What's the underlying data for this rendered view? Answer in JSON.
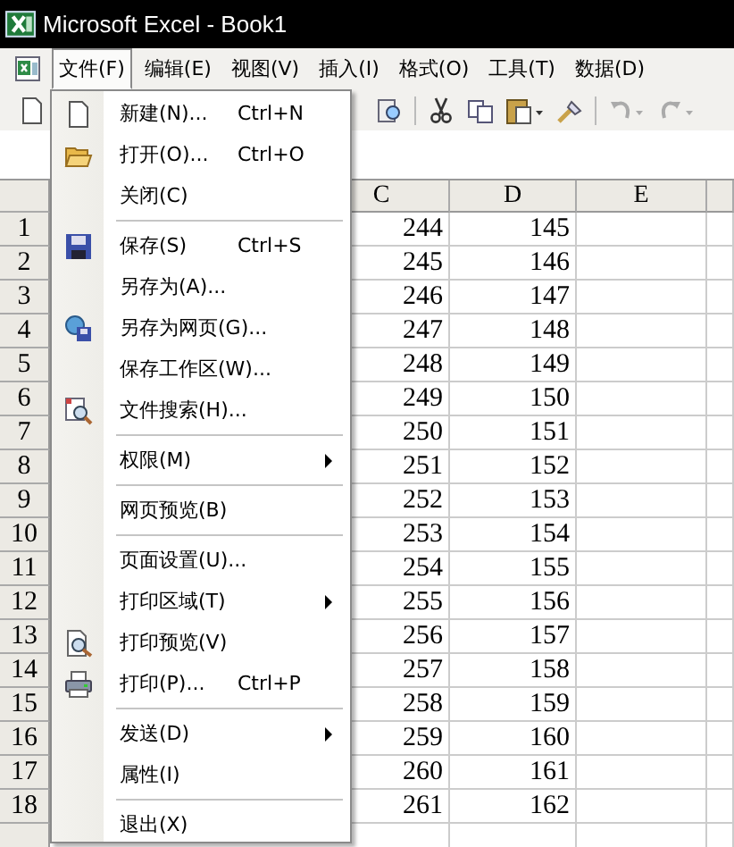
{
  "window": {
    "title": "Microsoft Excel - Book1"
  },
  "menu_bar": [
    {
      "label": "文件(F)",
      "selected": true
    },
    {
      "label": "编辑(E)",
      "selected": false
    },
    {
      "label": "视图(V)",
      "selected": false
    },
    {
      "label": "插入(I)",
      "selected": false
    },
    {
      "label": "格式(O)",
      "selected": false
    },
    {
      "label": "工具(T)",
      "selected": false
    },
    {
      "label": "数据(D)",
      "selected": false
    }
  ],
  "file_menu": {
    "groups": [
      [
        {
          "label": "新建(N)...",
          "shortcut": "Ctrl+N",
          "kind": "page",
          "submenu": false
        },
        {
          "label": "打开(O)...",
          "shortcut": "Ctrl+O",
          "kind": "folder",
          "submenu": false
        },
        {
          "label": "关闭(C)",
          "submenu": false
        }
      ],
      [
        {
          "label": "保存(S)",
          "shortcut": "Ctrl+S",
          "kind": "disk",
          "submenu": false
        },
        {
          "label": "另存为(A)...",
          "submenu": false
        },
        {
          "label": "另存为网页(G)...",
          "kind": "globe",
          "submenu": false
        },
        {
          "label": "保存工作区(W)...",
          "submenu": false
        },
        {
          "label": "文件搜索(H)...",
          "kind": "search",
          "submenu": false
        }
      ],
      [
        {
          "label": "权限(M)",
          "submenu": true
        }
      ],
      [
        {
          "label": "网页预览(B)",
          "submenu": false
        }
      ],
      [
        {
          "label": "页面设置(U)...",
          "submenu": false
        },
        {
          "label": "打印区域(T)",
          "submenu": true
        },
        {
          "label": "打印预览(V)",
          "kind": "preview",
          "submenu": false
        },
        {
          "label": "打印(P)...",
          "shortcut": "Ctrl+P",
          "kind": "printer",
          "submenu": false
        }
      ],
      [
        {
          "label": "发送(D)",
          "submenu": true
        },
        {
          "label": "属性(I)",
          "submenu": false
        }
      ],
      [
        {
          "label": "退出(X)",
          "submenu": false
        }
      ]
    ]
  },
  "sheet": {
    "columns": [
      "C",
      "D",
      "E"
    ],
    "rows": [
      {
        "number": "1",
        "cells": [
          "244",
          "145"
        ]
      },
      {
        "number": "2",
        "cells": [
          "245",
          "146"
        ]
      },
      {
        "number": "3",
        "cells": [
          "246",
          "147"
        ]
      },
      {
        "number": "4",
        "cells": [
          "247",
          "148"
        ]
      },
      {
        "number": "5",
        "cells": [
          "248",
          "149"
        ]
      },
      {
        "number": "6",
        "cells": [
          "249",
          "150"
        ]
      },
      {
        "number": "7",
        "cells": [
          "250",
          "151"
        ]
      },
      {
        "number": "8",
        "cells": [
          "251",
          "152"
        ]
      },
      {
        "number": "9",
        "cells": [
          "252",
          "153"
        ]
      },
      {
        "number": "10",
        "cells": [
          "253",
          "154"
        ]
      },
      {
        "number": "11",
        "cells": [
          "254",
          "155"
        ]
      },
      {
        "number": "12",
        "cells": [
          "255",
          "156"
        ]
      },
      {
        "number": "13",
        "cells": [
          "256",
          "157"
        ]
      },
      {
        "number": "14",
        "cells": [
          "257",
          "158"
        ]
      },
      {
        "number": "15",
        "cells": [
          "258",
          "159"
        ]
      },
      {
        "number": "16",
        "cells": [
          "259",
          "160"
        ]
      },
      {
        "number": "17",
        "cells": [
          "260",
          "161"
        ]
      },
      {
        "number": "18",
        "cells": [
          "261",
          "162"
        ]
      }
    ]
  }
}
